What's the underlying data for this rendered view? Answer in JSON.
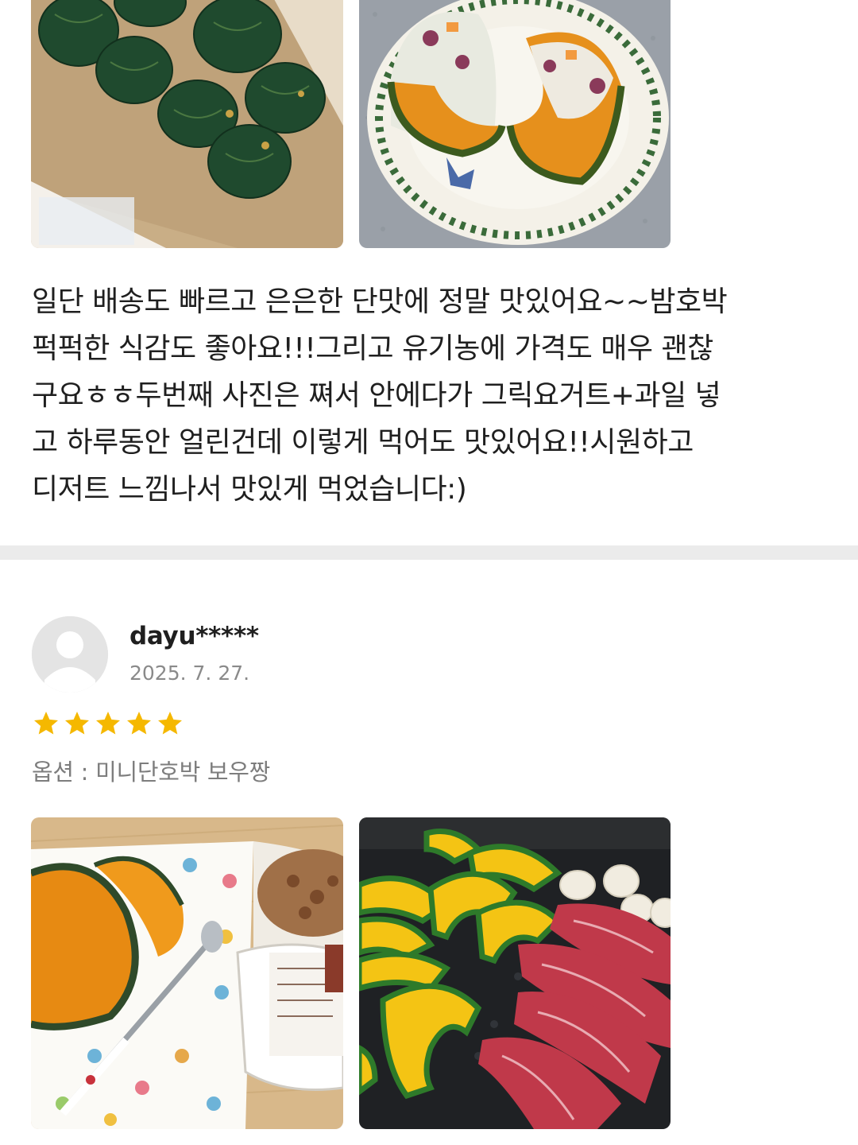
{
  "previous_review": {
    "photos": [
      {
        "icon": "photo-pumpkins-in-box-icon"
      },
      {
        "icon": "photo-stuffed-pumpkin-plate-icon"
      }
    ],
    "lines": [
      "일단 배송도 빠르고 은은한 단맛에 정말 맛있어요~~밤호박",
      "퍽퍽한 식감도 좋아요!!!그리고 유기농에 가격도 매우 괜찮",
      "구요ㅎㅎ두번째 사진은 쪄서 안에다가 그릭요거트+과일 넣",
      "고 하루동안 얼린건데 이렇게 먹어도 맛있어요!!시원하고",
      "디저트 느낌나서 맛있게 먹었습니다:)"
    ]
  },
  "review": {
    "avatar_icon": "user-avatar-icon",
    "username": "dayu*****",
    "date": "2025. 7. 27.",
    "rating": 5,
    "rating_max": 5,
    "star_color": "#f5b800",
    "option": "옵션 : 미니단호박 보우짱",
    "photos": [
      {
        "icon": "photo-pumpkin-and-yogurt-icon"
      },
      {
        "icon": "photo-grilled-pumpkin-and-beef-icon"
      }
    ]
  },
  "colors": {
    "divider": "#ebebeb",
    "text": "#1f1f1f",
    "muted": "#8a8a8a"
  }
}
